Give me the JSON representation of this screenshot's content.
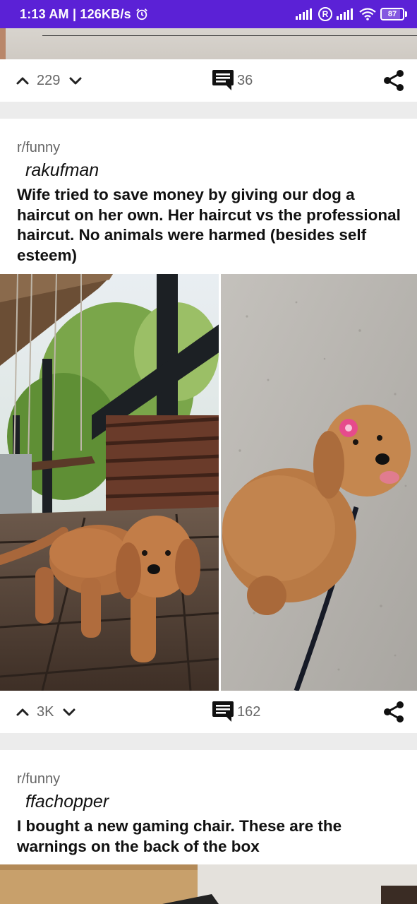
{
  "status_bar": {
    "time": "1:13 AM | 126KB/s",
    "battery": "87",
    "battery_level": 0.87,
    "icons": [
      "alarm-icon",
      "signal-icon",
      "roaming-r-icon",
      "signal-icon",
      "wifi-icon",
      "battery-icon"
    ]
  },
  "colors": {
    "status_bar": "#5b21d6",
    "background": "#ececec",
    "card": "#ffffff",
    "meta_text": "#666666"
  },
  "posts": [
    {
      "votes": "229",
      "comments": "36"
    },
    {
      "subreddit": "r/funny",
      "author": "rakufman",
      "title": "Wife tried to save money by giving our dog a haircut on her own. Her haircut vs the professional haircut. No animals were harmed (besides self esteem)",
      "votes": "3K",
      "comments": "162"
    },
    {
      "subreddit": "r/funny",
      "author": "ffachopper",
      "title": "I bought a new gaming chair. These are the warnings on the back of the box"
    }
  ]
}
